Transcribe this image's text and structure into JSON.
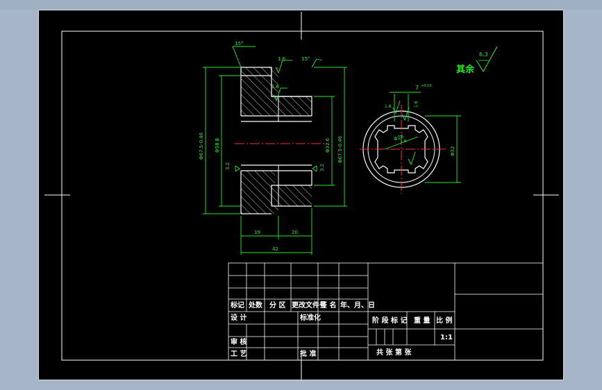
{
  "drawing": {
    "dims": {
      "angle_left": "15°",
      "angle_right": "15°",
      "rough_top": "1.6",
      "rough_inner": "1.6",
      "rough_left": "3.2",
      "rough_right": "3.2",
      "dia_outer": "Φ67.5-0.46",
      "dia_hub": "Φ58.8",
      "dia_bore": "Φ32.6",
      "dia_hub_right": "Φ67.5-0.46",
      "len_a": "19",
      "len_b": "20",
      "len_total": "42",
      "key_width": "7",
      "key_tol": "+0.03",
      "key_rough1": "1.6",
      "key_rough2": "1.6",
      "key_rough3": "1.6",
      "spline_dia": "Φ28",
      "spline_dia2": "Φ32",
      "remaining_label": "其余",
      "remaining_value": "6.3"
    }
  },
  "title_block": {
    "labels": {
      "mark": "标记",
      "count": "处数",
      "zone": "分 区",
      "doc": "更改文件号",
      "sign": "签 名",
      "date": "年、月、日",
      "design": "设 计",
      "standard": "标准化",
      "review": "审 核",
      "process": "工 艺",
      "approve": "批 准",
      "stage": "阶 段 标 记",
      "weight": "重 量",
      "ratio": "比 例",
      "scale": "1:1",
      "sheets": "共    张  第    张"
    }
  }
}
